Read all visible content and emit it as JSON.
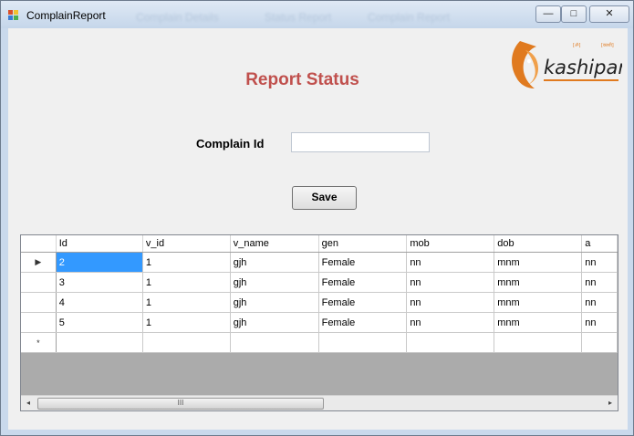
{
  "window": {
    "title": "ComplainReport",
    "ghost_tabs": [
      "Complain Details",
      "Status Report",
      "Complain Report"
    ],
    "controls": {
      "minimize": "—",
      "maximize": "□",
      "close": "✕"
    }
  },
  "logo": {
    "text": "kashipara",
    "tagline_1": "[ॐ]",
    "tagline_2": "[काशी]",
    "brand_color": "#e07a1f"
  },
  "form": {
    "heading": "Report Status",
    "complain_id_label": "Complain Id",
    "complain_id_value": "",
    "save_label": "Save"
  },
  "grid": {
    "columns": [
      "Id",
      "v_id",
      "v_name",
      "gen",
      "mob",
      "dob",
      "a"
    ],
    "rows": [
      [
        "2",
        "1",
        "gjh",
        "Female",
        "nn",
        "mnm",
        "nn"
      ],
      [
        "3",
        "1",
        "gjh",
        "Female",
        "nn",
        "mnm",
        "nn"
      ],
      [
        "4",
        "1",
        "gjh",
        "Female",
        "nn",
        "mnm",
        "nn"
      ],
      [
        "5",
        "1",
        "gjh",
        "Female",
        "nn",
        "mnm",
        "nn"
      ]
    ],
    "current_row_marker": "▶",
    "new_row_marker": "*",
    "scroll_left": "◂",
    "scroll_right": "▸",
    "scroll_grip": "III"
  },
  "colors": {
    "heading": "#c0504d",
    "selection": "#3399ff"
  }
}
